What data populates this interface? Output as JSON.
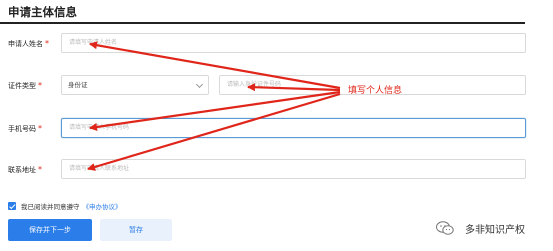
{
  "section": {
    "title": "申请主体信息"
  },
  "fields": {
    "name": {
      "label": "申请人姓名",
      "required": "*",
      "placeholder": "请填写申请人姓名"
    },
    "id_type": {
      "label": "证件类型",
      "required": "*",
      "selected": "身份证"
    },
    "id_number": {
      "placeholder": "请输入身份证件号码"
    },
    "phone": {
      "label": "手机号码",
      "required": "*",
      "placeholder": "请填写申请人手机号码"
    },
    "address": {
      "label": "联系地址",
      "required": "*",
      "placeholder": "请填写申请人联系地址"
    }
  },
  "annotation": {
    "text": "填写个人信息",
    "color": "#e0261a"
  },
  "agreement": {
    "checked": true,
    "text": "我已阅读并同意遵守",
    "link": "《申办协议》"
  },
  "buttons": {
    "primary": "保存并下一步",
    "secondary": "暂存"
  },
  "watermark": {
    "text": "多非知识产权",
    "icon": "wechat-icon"
  },
  "colors": {
    "accent": "#2b7de9",
    "required": "#e0261a",
    "focus_border": "#5b9bd5"
  }
}
